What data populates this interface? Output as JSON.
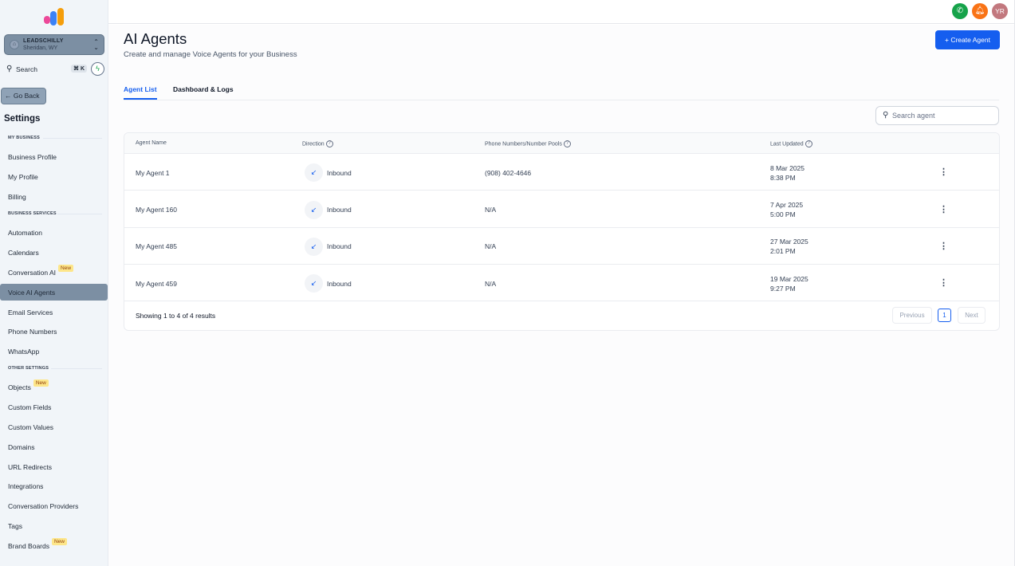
{
  "sidebar": {
    "account": {
      "name": "LEADSCHILLY",
      "location": "Sheridan, WY"
    },
    "search": {
      "label": "Search",
      "shortcut": "⌘ K"
    },
    "go_back": "Go Back",
    "title": "Settings",
    "sections": {
      "my_business": {
        "heading": "MY BUSINESS",
        "items": [
          {
            "label": "Business Profile"
          },
          {
            "label": "My Profile"
          },
          {
            "label": "Billing"
          }
        ]
      },
      "business_services": {
        "heading": "BUSINESS SERVICES",
        "items": [
          {
            "label": "Automation"
          },
          {
            "label": "Calendars"
          },
          {
            "label": "Conversation AI",
            "badge": "New"
          },
          {
            "label": "Voice AI Agents",
            "active": true
          },
          {
            "label": "Email Services"
          },
          {
            "label": "Phone Numbers"
          },
          {
            "label": "WhatsApp"
          }
        ]
      },
      "other_settings": {
        "heading": "OTHER SETTINGS",
        "items": [
          {
            "label": "Objects",
            "badge": "New"
          },
          {
            "label": "Custom Fields"
          },
          {
            "label": "Custom Values"
          },
          {
            "label": "Domains"
          },
          {
            "label": "URL Redirects"
          },
          {
            "label": "Integrations"
          },
          {
            "label": "Conversation Providers"
          },
          {
            "label": "Tags"
          },
          {
            "label": "Brand Boards",
            "badge": "New"
          }
        ]
      }
    }
  },
  "topbar": {
    "avatar_initials": "YR",
    "icons": [
      "phone-icon",
      "bell-icon"
    ],
    "colors": {
      "phone": "#16a34a",
      "bell": "#f97316",
      "avatar": "#c2787e"
    }
  },
  "main": {
    "title": "AI Agents",
    "subtitle": "Create and manage Voice Agents for your Business",
    "create_button": "+ Create Agent",
    "tabs": [
      {
        "label": "Agent List",
        "active": true
      },
      {
        "label": "Dashboard & Logs",
        "active": false
      }
    ],
    "search_placeholder": "Search agent",
    "table": {
      "columns": [
        "Agent Name",
        "Direction",
        "Phone Numbers/Number Pools",
        "Last Updated"
      ],
      "rows": [
        {
          "name": "My Agent 1",
          "direction": "Inbound",
          "phone": "(908) 402-4646",
          "date": "8 Mar 2025",
          "time": "8:38 PM"
        },
        {
          "name": "My Agent 160",
          "direction": "Inbound",
          "phone": "N/A",
          "date": "7 Apr 2025",
          "time": "5:00 PM"
        },
        {
          "name": "My Agent 485",
          "direction": "Inbound",
          "phone": "N/A",
          "date": "27 Mar 2025",
          "time": "2:01 PM"
        },
        {
          "name": "My Agent 459",
          "direction": "Inbound",
          "phone": "N/A",
          "date": "19 Mar 2025",
          "time": "9:27 PM"
        }
      ]
    },
    "pagination": {
      "summary": "Showing 1 to 4 of 4 results",
      "previous": "Previous",
      "page": "1",
      "next": "Next"
    }
  },
  "colors": {
    "accent": "#155eef",
    "sidebar_active": "#7c8fa3",
    "badge": "#fde68a"
  }
}
